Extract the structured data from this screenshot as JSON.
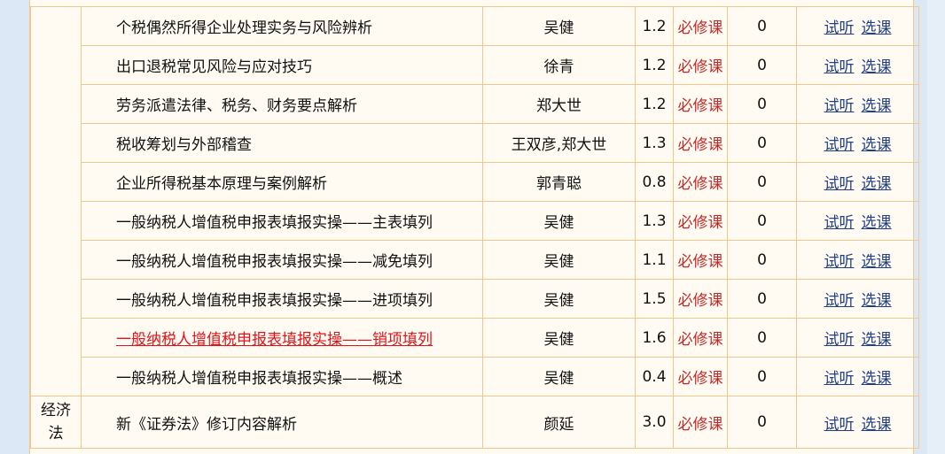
{
  "rows": [
    {
      "name": "个税偶然所得企业处理实务与风险辨析",
      "teacher": "吴健",
      "hours": "1.2",
      "type": "必修课",
      "count": "0",
      "trial": "试听",
      "select": "选课"
    },
    {
      "name": "出口退税常见风险与应对技巧",
      "teacher": "徐青",
      "hours": "1.2",
      "type": "必修课",
      "count": "0",
      "trial": "试听",
      "select": "选课"
    },
    {
      "name": "劳务派遣法律、税务、财务要点解析",
      "teacher": "郑大世",
      "hours": "1.2",
      "type": "必修课",
      "count": "0",
      "trial": "试听",
      "select": "选课"
    },
    {
      "name": "税收筹划与外部稽查",
      "teacher": "王双彦,郑大世",
      "hours": "1.3",
      "type": "必修课",
      "count": "0",
      "trial": "试听",
      "select": "选课"
    },
    {
      "name": "企业所得税基本原理与案例解析",
      "teacher": "郭青聪",
      "hours": "0.8",
      "type": "必修课",
      "count": "0",
      "trial": "试听",
      "select": "选课"
    },
    {
      "name": "一般纳税人增值税申报表填报实操——主表填列",
      "teacher": "吴健",
      "hours": "1.3",
      "type": "必修课",
      "count": "0",
      "trial": "试听",
      "select": "选课"
    },
    {
      "name": "一般纳税人增值税申报表填报实操——减免填列",
      "teacher": "吴健",
      "hours": "1.1",
      "type": "必修课",
      "count": "0",
      "trial": "试听",
      "select": "选课"
    },
    {
      "name": "一般纳税人增值税申报表填报实操——进项填列",
      "teacher": "吴健",
      "hours": "1.5",
      "type": "必修课",
      "count": "0",
      "trial": "试听",
      "select": "选课"
    },
    {
      "name": "一般纳税人增值税申报表填报实操——销项填列",
      "teacher": "吴健",
      "hours": "1.6",
      "type": "必修课",
      "count": "0",
      "trial": "试听",
      "select": "选课"
    },
    {
      "name": "一般纳税人增值税申报表填报实操——概述",
      "teacher": "吴健",
      "hours": "0.4",
      "type": "必修课",
      "count": "0",
      "trial": "试听",
      "select": "选课"
    }
  ],
  "category2": {
    "label": "经济法",
    "name": "新《证券法》修订内容解析",
    "teacher": "颜延",
    "hours": "3.0",
    "type": "必修课",
    "count": "0",
    "trial": "试听",
    "select": "选课"
  },
  "colors": {
    "border": "#f0c88a",
    "row_bg": "#fffbf2",
    "page_bg": "#dce8f6",
    "type_text": "#c22a2a",
    "link": "#1f3f86",
    "highlight_link": "#e0131b"
  }
}
